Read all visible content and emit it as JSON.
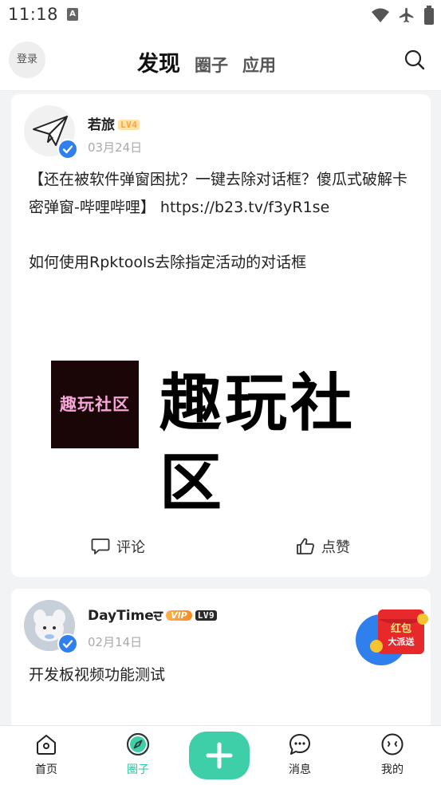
{
  "status": {
    "time": "11:18",
    "notif_icon": "A"
  },
  "header": {
    "login_label": "登录",
    "tabs": [
      {
        "label": "发现",
        "active": true
      },
      {
        "label": "圈子",
        "active": false
      },
      {
        "label": "应用",
        "active": false
      }
    ]
  },
  "posts": [
    {
      "user": "若旅",
      "level": "LV4",
      "date": "03月24日",
      "paragraphs": [
        "【还在被软件弹窗困扰？一键去除对话框？傻瓜式破解卡密弹窗-哔哩哔哩】 https://b23.tv/f3yR1se",
        "如何使用Rpktools去除指定活动的对话框"
      ],
      "image_logo_small": "趣玩社区",
      "image_logo_large": "趣玩社区",
      "comment_label": "评论",
      "like_label": "点赞"
    },
    {
      "user": "DayTimeਦ",
      "vip": "VIP",
      "level": "LV9",
      "date": "02月14日",
      "text": "开发板视频功能测试"
    }
  ],
  "redpacket": {
    "line1": "红包",
    "line2": "大派送"
  },
  "bottom_nav": [
    {
      "label": "首页",
      "icon": "home-icon"
    },
    {
      "label": "圈子",
      "icon": "compass-icon",
      "active": true
    },
    {
      "label": "消息",
      "icon": "chat-icon"
    },
    {
      "label": "我的",
      "icon": "profile-icon"
    }
  ],
  "colors": {
    "accent": "#3fcfa8",
    "active_nav": "#2fc4a0"
  }
}
